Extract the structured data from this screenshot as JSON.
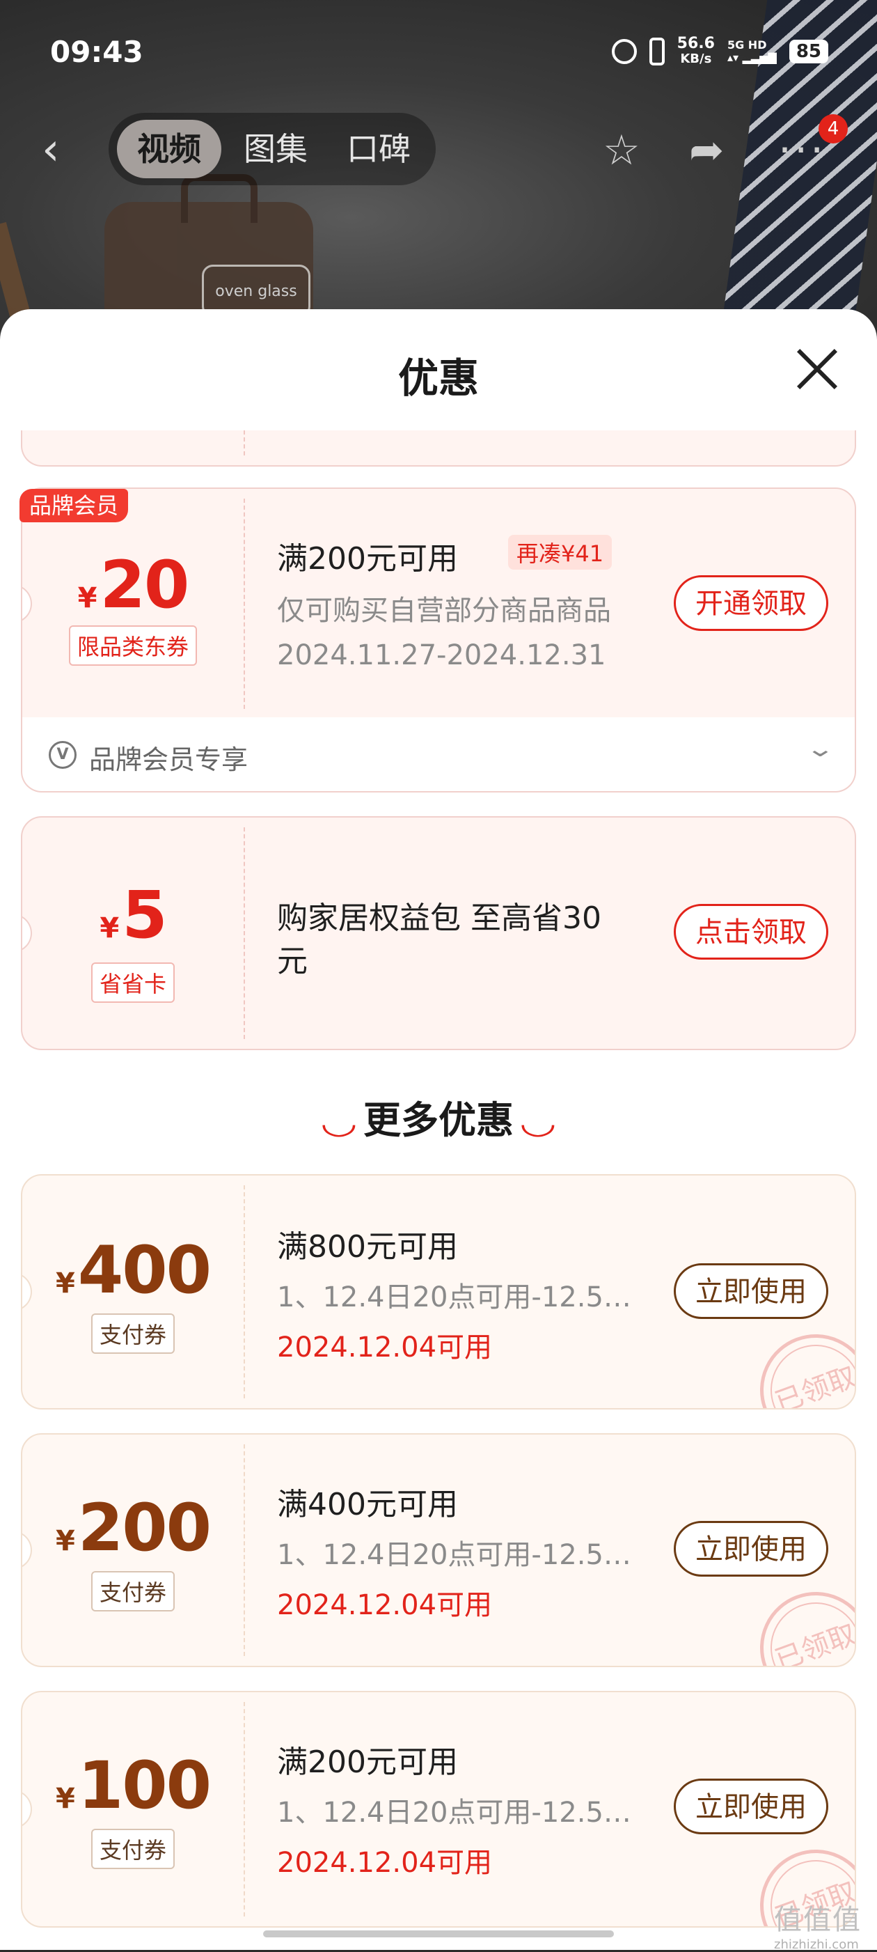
{
  "status_bar": {
    "time": "09:43",
    "speed_value": "56.6",
    "speed_unit": "KB/s",
    "network_5g": "5G",
    "network_hd": "HD",
    "battery": "85"
  },
  "top_nav": {
    "tabs": [
      {
        "label": "视频",
        "active": true
      },
      {
        "label": "图集",
        "active": false
      },
      {
        "label": "口碑",
        "active": false
      }
    ],
    "more_badge": "4",
    "product_label": "oven glass"
  },
  "sheet": {
    "title": "优惠"
  },
  "member_coupon": {
    "badge": "品牌会员",
    "currency": "¥",
    "amount": "20",
    "kind": "限品类东券",
    "title": "满200元可用",
    "again_tag": "再凑¥41",
    "desc": "仅可购买自营部分商品商品",
    "date": "2024.11.27-2024.12.31",
    "button": "开通领取",
    "footer_icon": "V",
    "footer_text": "品牌会员专享"
  },
  "saver_coupon": {
    "currency": "¥",
    "amount": "5",
    "kind": "省省卡",
    "title_line1": "购家居权益包 至高省30",
    "title_line2": "元",
    "button": "点击领取"
  },
  "more_section": {
    "title": "更多优惠"
  },
  "pay_coupons": [
    {
      "currency": "¥",
      "amount": "400",
      "kind": "支付券",
      "title": "满800元可用",
      "desc": "1、12.4日20点可用-12.5…",
      "date": "2024.12.04可用",
      "button": "立即使用",
      "stamp": "已领取"
    },
    {
      "currency": "¥",
      "amount": "200",
      "kind": "支付券",
      "title": "满400元可用",
      "desc": "1、12.4日20点可用-12.5…",
      "date": "2024.12.04可用",
      "button": "立即使用",
      "stamp": "已领取"
    },
    {
      "currency": "¥",
      "amount": "100",
      "kind": "支付券",
      "title": "满200元可用",
      "desc": "1、12.4日20点可用-12.5…",
      "date": "2024.12.04可用",
      "button": "立即使用",
      "stamp": "已领取"
    }
  ],
  "watermark": {
    "logo": "值值值",
    "site": "zhizhizhi.com"
  },
  "colors": {
    "accent_red": "#e2231a",
    "gold_brown": "#8b3b0e",
    "card_pink": "#fff4f1"
  }
}
